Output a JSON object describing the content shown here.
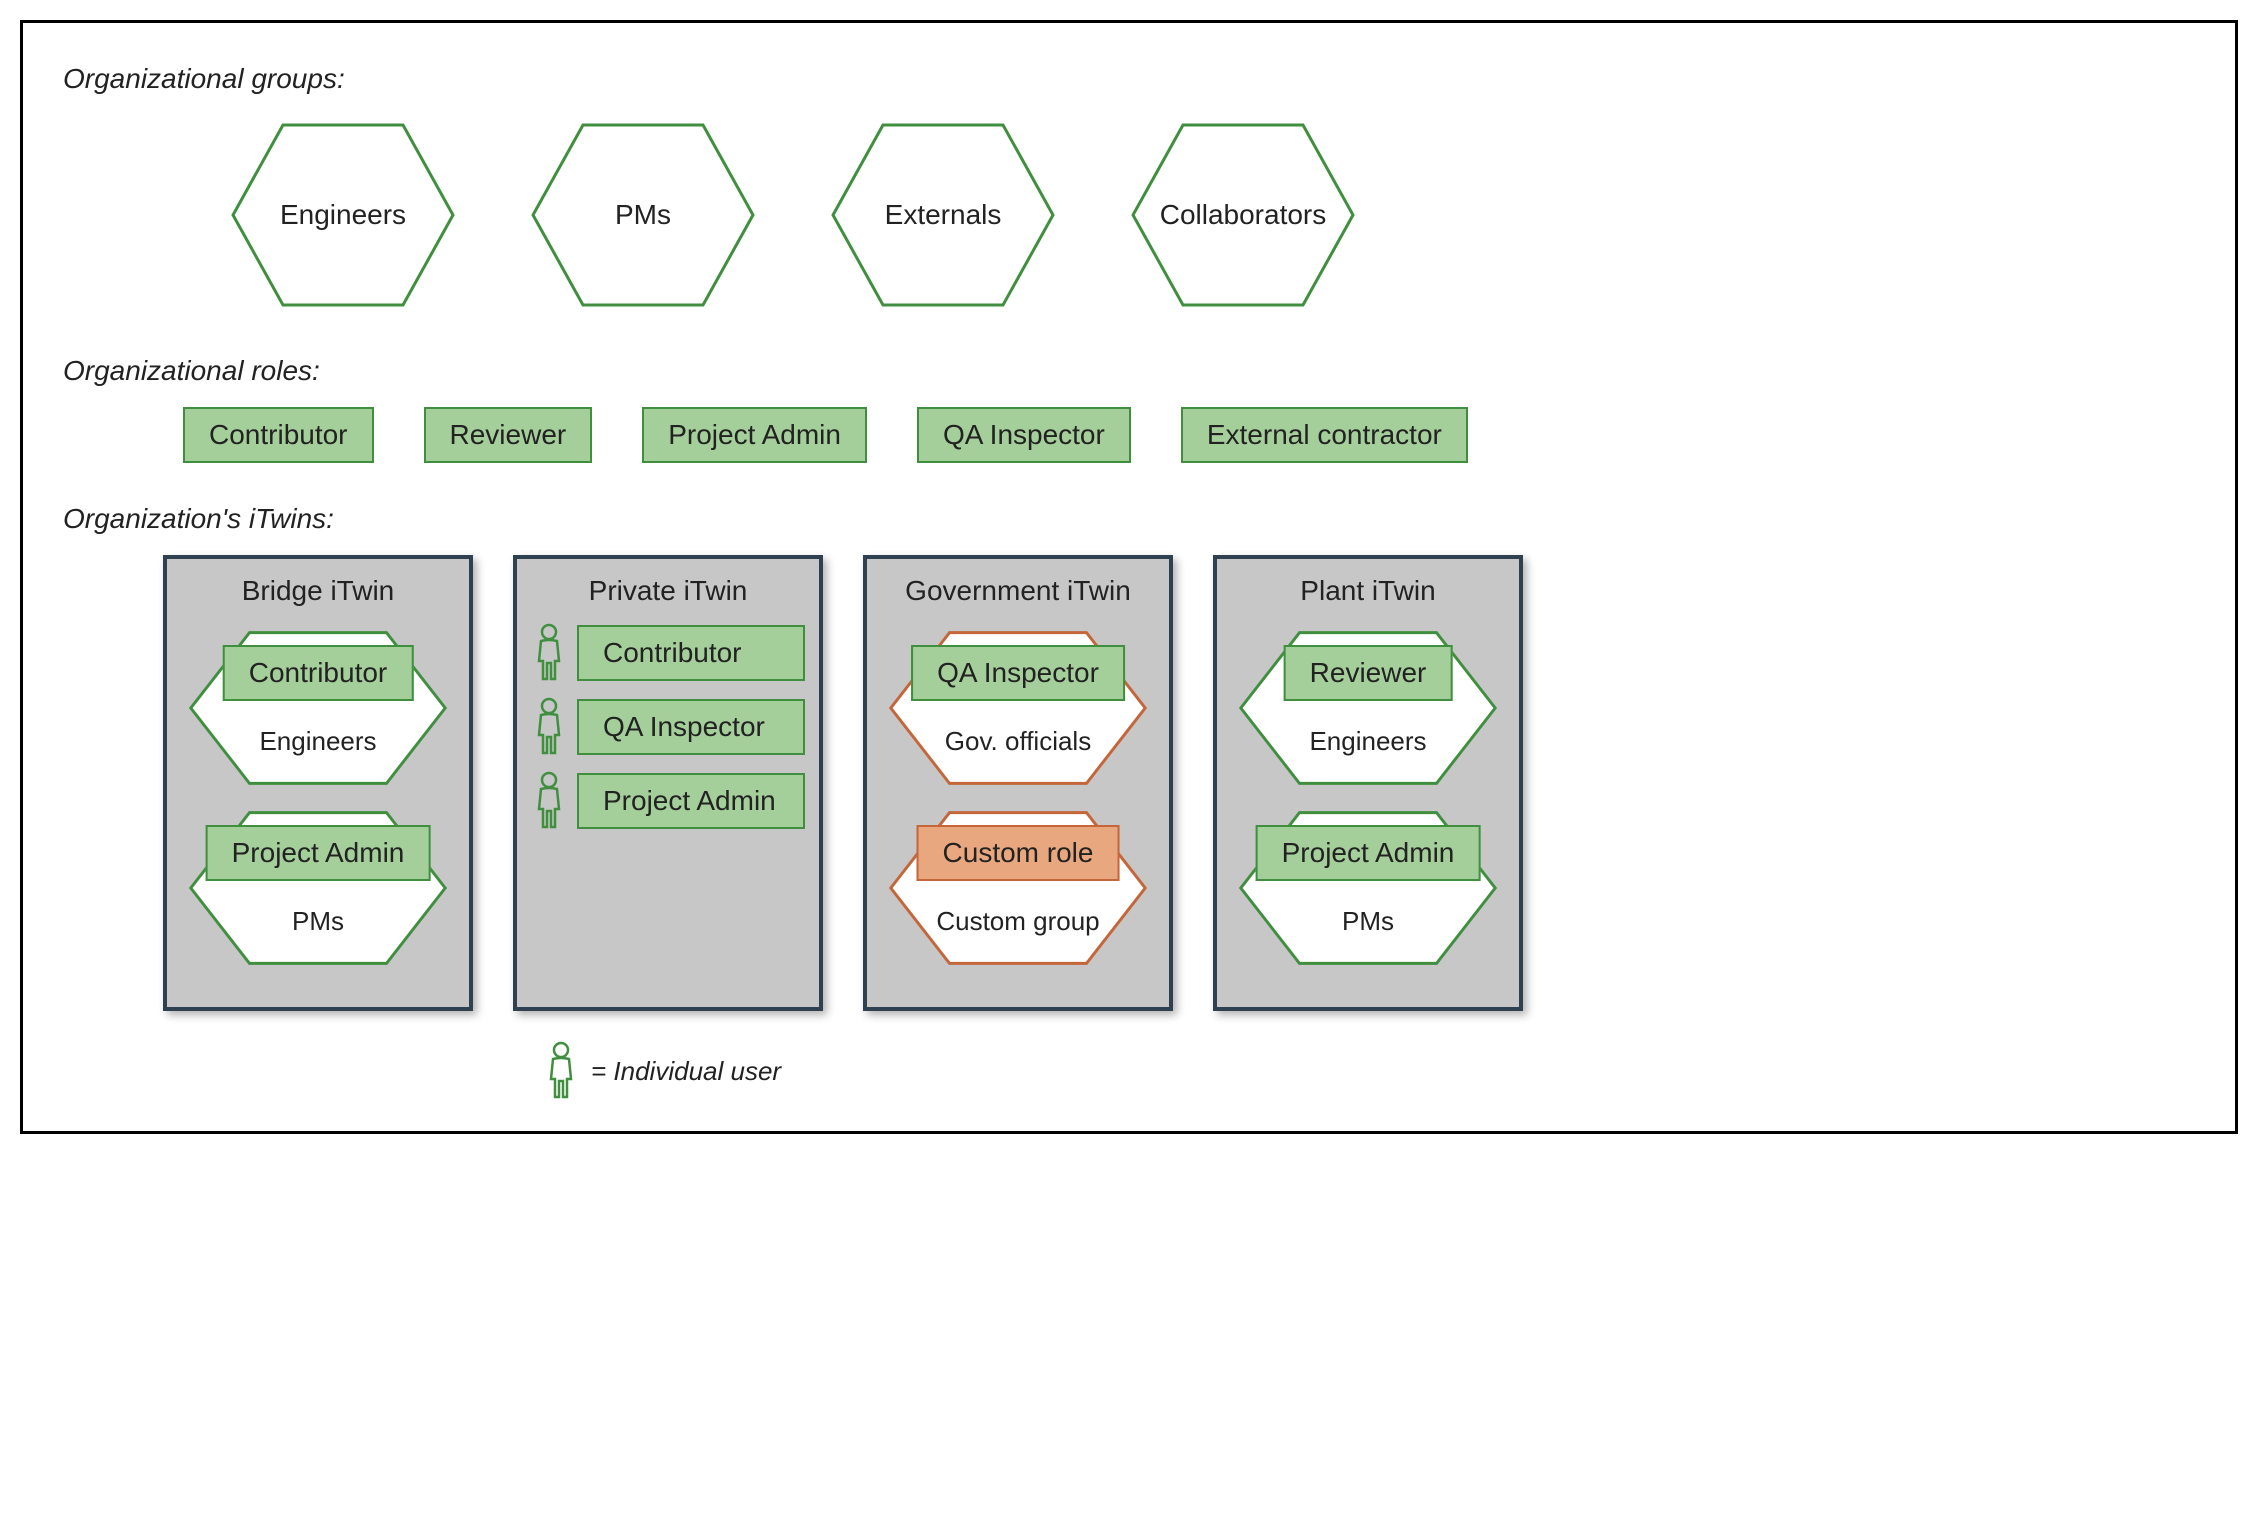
{
  "colors": {
    "green_stroke": "#3f8f3f",
    "green_fill": "#a5cf9a",
    "orange_stroke": "#c4663a",
    "orange_fill": "#e8a77e",
    "card_border": "#2f4050",
    "card_bg": "#c7c7c7"
  },
  "sections": {
    "groups_label": "Organizational groups:",
    "roles_label": "Organizational roles:",
    "itwins_label": "Organization's iTwins:"
  },
  "organizational_groups": [
    "Engineers",
    "PMs",
    "Externals",
    "Collaborators"
  ],
  "organizational_roles": [
    "Contributor",
    "Reviewer",
    "Project Admin",
    "QA Inspector",
    "External contractor"
  ],
  "itwins": [
    {
      "title": "Bridge iTwin",
      "type": "hex_groups",
      "hex_color": "green",
      "items": [
        {
          "role": "Contributor",
          "group": "Engineers",
          "role_color": "green"
        },
        {
          "role": "Project Admin",
          "group": "PMs",
          "role_color": "green"
        }
      ]
    },
    {
      "title": "Private iTwin",
      "type": "user_rows",
      "items": [
        {
          "role": "Contributor"
        },
        {
          "role": "QA Inspector"
        },
        {
          "role": "Project Admin"
        }
      ]
    },
    {
      "title": "Government iTwin",
      "type": "hex_groups",
      "hex_color": "orange",
      "items": [
        {
          "role": "QA Inspector",
          "group": "Gov. officials",
          "role_color": "green"
        },
        {
          "role": "Custom role",
          "group": "Custom group",
          "role_color": "orange"
        }
      ]
    },
    {
      "title": "Plant iTwin",
      "type": "hex_groups",
      "hex_color": "green",
      "items": [
        {
          "role": "Reviewer",
          "group": "Engineers",
          "role_color": "green"
        },
        {
          "role": "Project Admin",
          "group": "PMs",
          "role_color": "green"
        }
      ]
    }
  ],
  "legend": {
    "text": "= Individual user"
  }
}
